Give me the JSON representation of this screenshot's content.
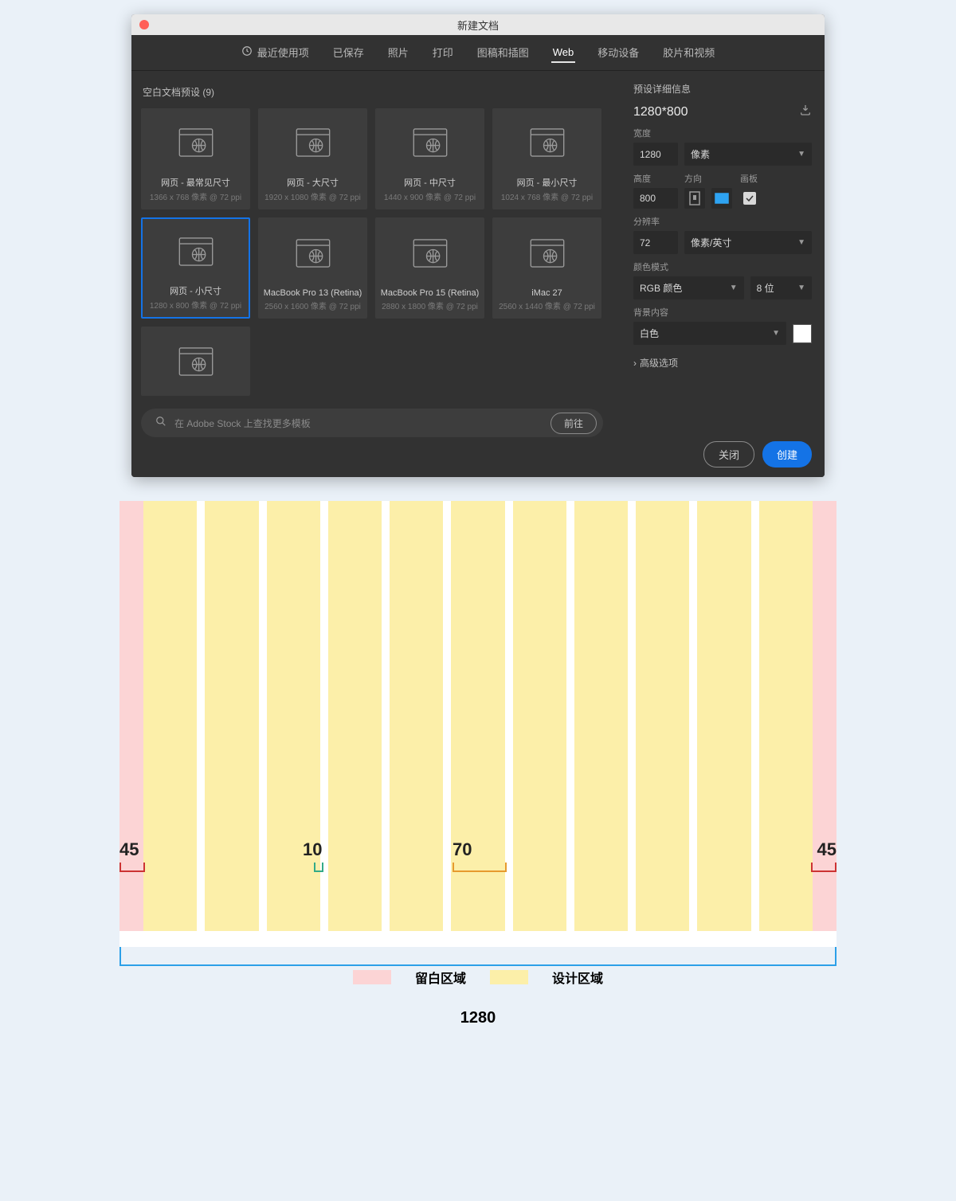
{
  "dialog": {
    "title": "新建文档",
    "close_dot_color": "#ff5f57"
  },
  "tabs": {
    "items": [
      {
        "label": "最近使用项",
        "icon": "clock"
      },
      {
        "label": "已保存"
      },
      {
        "label": "照片"
      },
      {
        "label": "打印"
      },
      {
        "label": "图稿和插图"
      },
      {
        "label": "Web"
      },
      {
        "label": "移动设备"
      },
      {
        "label": "胶片和视频"
      }
    ],
    "active_index": 5
  },
  "left": {
    "section_title": "空白文档预设  (9)",
    "cards": [
      {
        "label": "网页 - 最常见尺寸",
        "sub": "1366 x 768 像素 @ 72 ppi"
      },
      {
        "label": "网页 - 大尺寸",
        "sub": "1920 x 1080 像素 @ 72 ppi"
      },
      {
        "label": "网页 - 中尺寸",
        "sub": "1440 x 900 像素 @ 72 ppi"
      },
      {
        "label": "网页 - 最小尺寸",
        "sub": "1024 x 768 像素 @ 72 ppi"
      },
      {
        "label": "网页 - 小尺寸",
        "sub": "1280 x 800 像素 @ 72 ppi"
      },
      {
        "label": "MacBook Pro 13 (Retina)",
        "sub": "2560 x 1600 像素 @ 72 ppi"
      },
      {
        "label": "MacBook Pro 15 (Retina)",
        "sub": "2880 x 1800 像素 @ 72 ppi"
      },
      {
        "label": "iMac 27",
        "sub": "2560 x 1440 像素 @ 72 ppi"
      }
    ],
    "selected_index": 4,
    "stock_placeholder": "在 Adobe Stock 上查找更多模板",
    "go_label": "前往"
  },
  "right": {
    "title": "预设详细信息",
    "name": "1280*800",
    "width_label": "宽度",
    "width_value": "1280",
    "width_unit": "像素",
    "height_label": "高度",
    "height_value": "800",
    "orientation_label": "方向",
    "artboard_label": "画板",
    "artboard_checked": true,
    "resolution_label": "分辨率",
    "resolution_value": "72",
    "resolution_unit": "像素/英寸",
    "color_mode_label": "颜色模式",
    "color_mode_value": "RGB 颜色",
    "bit_depth_value": "8 位",
    "bg_label": "背景内容",
    "bg_value": "白色",
    "bg_swatch": "#ffffff",
    "advanced_label": "高级选项",
    "close_label": "关闭",
    "create_label": "创建"
  },
  "diagram": {
    "margin_left": "45",
    "margin_right": "45",
    "gutter": "10",
    "column_width": "70",
    "total_width": "1280",
    "legend_margin_label": "留白区域",
    "legend_design_label": "设计区域",
    "legend_margin_color": "#fcd4d5",
    "legend_design_color": "#fcefa9"
  }
}
